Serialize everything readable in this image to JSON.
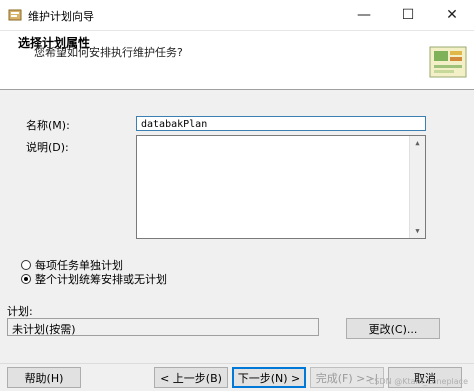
{
  "window": {
    "title": "维护计划向导",
    "minimize_glyph": "—",
    "maximize_glyph": "☐",
    "close_glyph": "✕"
  },
  "header": {
    "title": "选择计划属性",
    "subtitle": "您希望如何安排执行维护任务?"
  },
  "form": {
    "name_label": "名称(M):",
    "name_value": "databakPlan",
    "description_label": "说明(D):",
    "description_value": ""
  },
  "schedule_mode": {
    "options": [
      {
        "label": "每项任务单独计划",
        "checked": false
      },
      {
        "label": "整个计划统筹安排或无计划",
        "checked": true
      }
    ]
  },
  "schedule": {
    "label": "计划:",
    "value": "未计划(按需)",
    "change_button": "更改(C)..."
  },
  "footer": {
    "help_button": "帮助(H)",
    "back_button": "< 上一步(B)",
    "next_button": "下一步(N) >",
    "finish_button": "完成(F) >>|",
    "cancel_button": "取消"
  },
  "watermark": "CSDN @Ktam_Loneplace",
  "colors": {
    "focus_border": "#0078d7",
    "dialog_bg": "#f0f0f0"
  },
  "icons": {
    "app": "maintenance-plan-icon",
    "header_art": "wizard-banner-icon"
  }
}
